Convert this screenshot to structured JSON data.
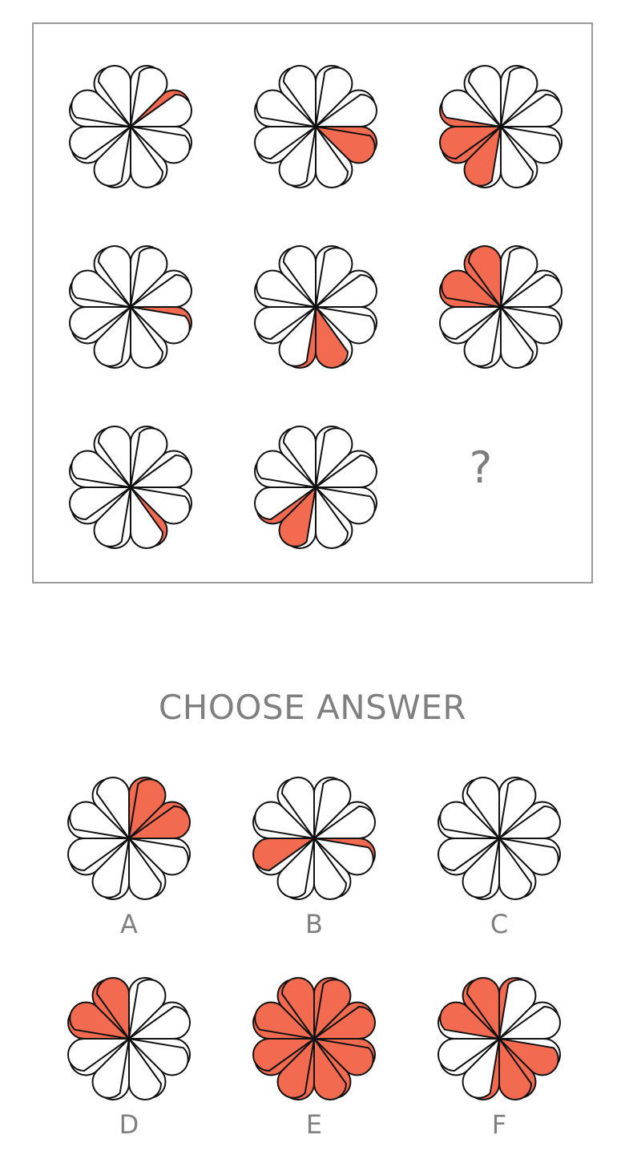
{
  "colors": {
    "accent": "#f26b50",
    "petal_empty": "#ffffff",
    "outline": "#111111",
    "frame": "#9a9a9a",
    "text": "#808080"
  },
  "petal_order": [
    "n-right",
    "ne-upper",
    "ne-lower",
    "e-upper",
    "e-lower",
    "se-upper",
    "se-lower",
    "s-right",
    "s-left",
    "sw-lower",
    "sw-upper",
    "w-lower",
    "w-upper",
    "nw-lower",
    "nw-upper",
    "n-left"
  ],
  "puzzle": {
    "cells": [
      {
        "name": "cell-1-1",
        "filled": [
          2
        ]
      },
      {
        "name": "cell-1-2",
        "filled": [
          4,
          5
        ]
      },
      {
        "name": "cell-1-3",
        "filled": [
          9,
          10,
          11,
          12
        ]
      },
      {
        "name": "cell-2-1",
        "filled": [
          4
        ]
      },
      {
        "name": "cell-2-2",
        "filled": [
          7,
          8
        ]
      },
      {
        "name": "cell-2-3",
        "filled": [
          12,
          13,
          14,
          15
        ]
      },
      {
        "name": "cell-3-1",
        "filled": [
          6
        ]
      },
      {
        "name": "cell-3-2",
        "filled": [
          9,
          10
        ]
      }
    ],
    "question_mark": "?"
  },
  "choose_title": "CHOOSE ANSWER",
  "answers": [
    {
      "label": "A",
      "filled": [
        0,
        1,
        2,
        3
      ]
    },
    {
      "label": "B",
      "filled": [
        4,
        11
      ]
    },
    {
      "label": "C",
      "filled": []
    },
    {
      "label": "D",
      "filled": [
        12,
        13,
        14,
        15
      ]
    },
    {
      "label": "E",
      "filled": [
        0,
        1,
        2,
        3,
        4,
        5,
        6,
        7,
        8,
        9,
        10,
        11,
        12,
        13,
        14,
        15
      ]
    },
    {
      "label": "F",
      "filled": [
        0,
        5,
        6,
        7,
        8,
        13,
        14,
        15
      ]
    }
  ]
}
